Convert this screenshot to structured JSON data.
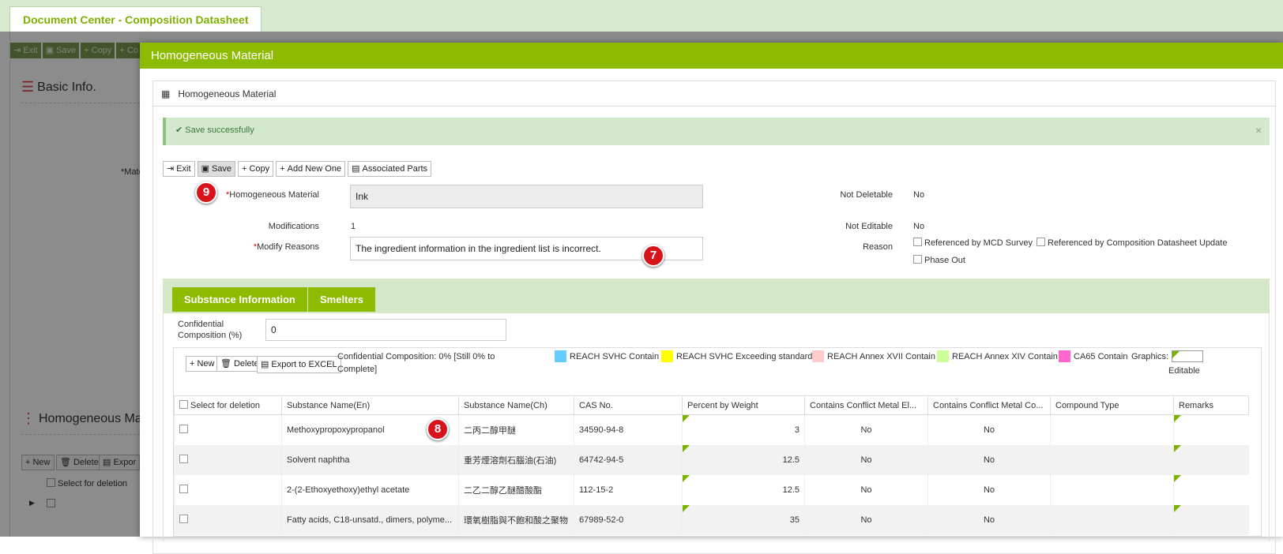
{
  "doc_tab": "Document Center - Composition Datasheet",
  "background": {
    "toolbar": [
      "Exit",
      "Save",
      "Copy",
      "Co"
    ],
    "basic_info_title": "Basic Info.",
    "mat_label": "*Mate",
    "homog_title": "Homogeneous Ma",
    "bottom_buttons": [
      "New",
      "Delete",
      "Expor"
    ],
    "select_for_deletion": "Select for deletion"
  },
  "modal": {
    "title": "Homogeneous Material",
    "panel_title": "Homogeneous Material",
    "alert": "Save successfully",
    "alert_close": "×",
    "toolbar": {
      "exit": "Exit",
      "save": "Save",
      "copy": "Copy",
      "add_new": "Add New One",
      "associated": "Associated Parts"
    },
    "form": {
      "hm_label": "Homogeneous Material",
      "hm_value": "Ink",
      "mod_label": "Modifications",
      "mod_value": "1",
      "reasons_label": "Modify Reasons",
      "reasons_value": "The ingredient information in the ingredient list is incorrect.",
      "not_deletable_label": "Not Deletable",
      "not_deletable_value": "No",
      "not_editable_label": "Not Editable",
      "not_editable_value": "No",
      "reason_label": "Reason",
      "reason_opt1": "Referenced by MCD Survey",
      "reason_opt2": "Referenced by Composition Datasheet Update",
      "reason_opt3": "Phase Out"
    },
    "badges": {
      "b9": "9",
      "b7": "7",
      "b8": "8"
    },
    "tabs": {
      "substance": "Substance Information",
      "smelters": "Smelters"
    },
    "conf_label_1": "Confidential",
    "conf_label_2": "Composition (%)",
    "conf_value": "0",
    "grid_buttons": {
      "new": "New",
      "delete": "Delete",
      "export": "Export to EXCEL"
    },
    "conf_status_1": "Confidential Composition: 0% [Still 0% to",
    "conf_status_2": "Complete]",
    "legend": {
      "svhc": "REACH SVHC Contain",
      "svhc_color": "#66ccff",
      "exceed": "REACH SVHC Exceeding standard",
      "exceed_color": "#ffff00",
      "annex17": "REACH Annex XVII Contain",
      "annex17_color": "#ffcccc",
      "annex14": "REACH Annex XIV Contain",
      "annex14_color": "#ccff99",
      "ca65": "CA65 Contain",
      "ca65_color": "#ff66cc",
      "graphics": "Graphics:",
      "editable": "Editable"
    },
    "columns": {
      "select": "Select for deletion",
      "name_en": "Substance Name(En)",
      "name_ch": "Substance Name(Ch)",
      "cas": "CAS No.",
      "percent": "Percent by Weight",
      "cmel": "Contains Conflict Metal El...",
      "cmco": "Contains Conflict Metal Co...",
      "compound": "Compound Type",
      "remarks": "Remarks"
    },
    "rows": [
      {
        "en": "Methoxypropoxypropanol",
        "ch": "二丙二醇甲醚",
        "cas": "34590-94-8",
        "pct": "3",
        "el": "No",
        "co": "No"
      },
      {
        "en": "Solvent naphtha",
        "ch": "重芳煙溶劑石腦油(石油)",
        "cas": "64742-94-5",
        "pct": "12.5",
        "el": "No",
        "co": "No"
      },
      {
        "en": "2-(2-Ethoxyethoxy)ethyl acetate",
        "ch": "二乙二醇乙醚醋酸酯",
        "cas": "112-15-2",
        "pct": "12.5",
        "el": "No",
        "co": "No"
      },
      {
        "en": "Fatty acids, C18-unsatd., dimers, polyme...",
        "ch": "環氧樹脂與不飽和酸之聚物",
        "cas": "67989-52-0",
        "pct": "35",
        "el": "No",
        "co": "No"
      }
    ]
  }
}
